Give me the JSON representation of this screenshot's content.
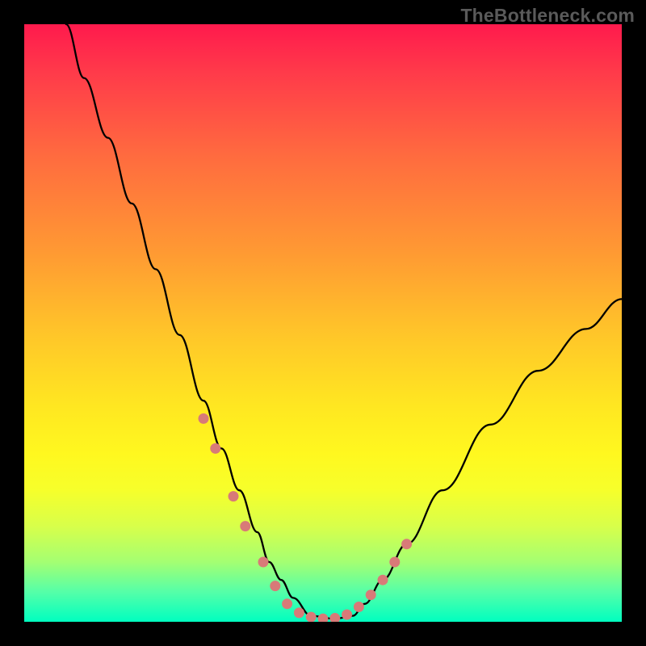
{
  "watermark": "TheBottleneck.com",
  "colors": {
    "curve": "#000000",
    "marker": "#d87a78",
    "gradient_top": "#ff1a4d",
    "gradient_bottom": "#00ffc0"
  },
  "chart_data": {
    "type": "line",
    "title": "",
    "xlabel": "",
    "ylabel": "",
    "xlim": [
      0,
      100
    ],
    "ylim": [
      0,
      100
    ],
    "grid": false,
    "legend": false,
    "series": [
      {
        "name": "curve",
        "x": [
          7,
          10,
          14,
          18,
          22,
          26,
          30,
          33,
          36,
          39,
          41,
          43,
          45,
          48,
          52,
          55,
          57,
          60,
          64,
          70,
          78,
          86,
          94,
          100
        ],
        "y": [
          100,
          91,
          81,
          70,
          59,
          48,
          37,
          29,
          22,
          15,
          10,
          7,
          4,
          1,
          0.5,
          1,
          3,
          7,
          13,
          22,
          33,
          42,
          49,
          54
        ]
      }
    ],
    "markers": {
      "name": "highlighted-points",
      "x": [
        30,
        32,
        35,
        37,
        40,
        42,
        44,
        46,
        48,
        50,
        52,
        54,
        56,
        58,
        60,
        62,
        64
      ],
      "y": [
        34,
        29,
        21,
        16,
        10,
        6,
        3,
        1.5,
        0.8,
        0.5,
        0.6,
        1.2,
        2.5,
        4.5,
        7,
        10,
        13
      ]
    }
  }
}
